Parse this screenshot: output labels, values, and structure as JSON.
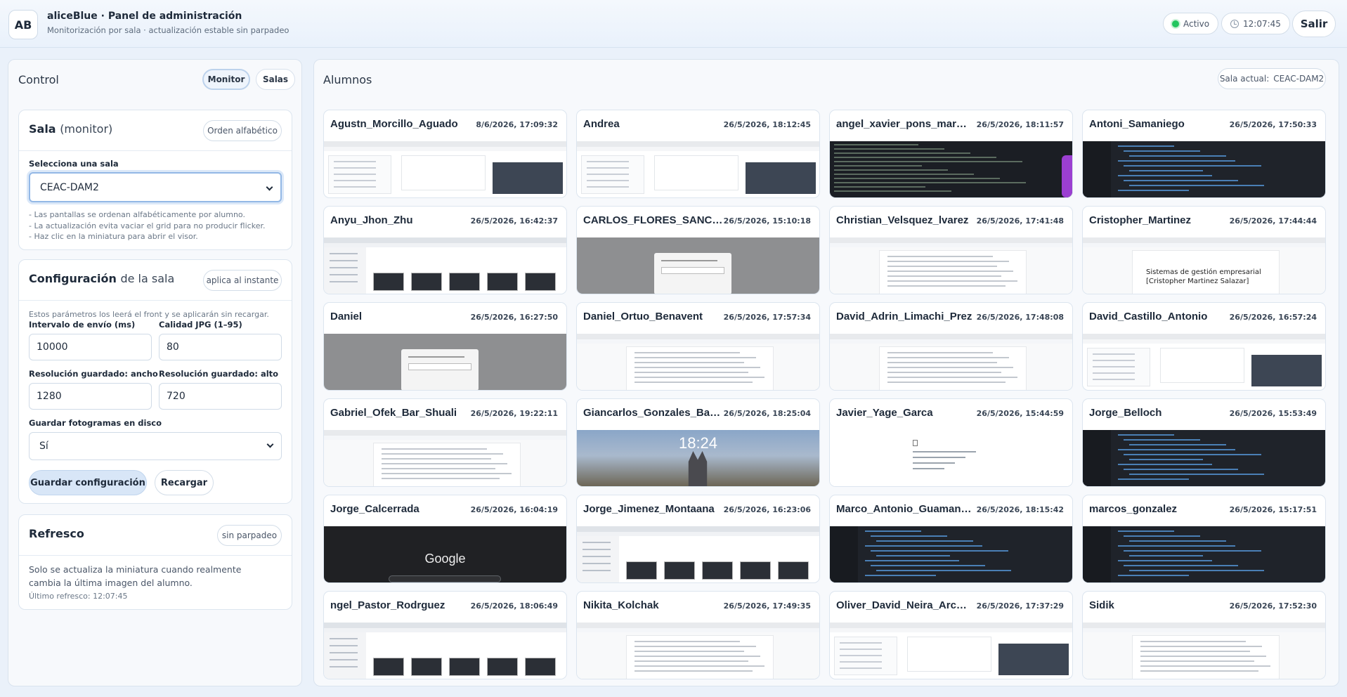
{
  "header": {
    "avatar": "AB",
    "title": "aliceBlue · Panel de administración",
    "subtitle": "Monitorización por sala · actualización estable sin parpadeo",
    "status": "Activo",
    "clock": "12:07:45",
    "exit": "Salir"
  },
  "control": {
    "title": "Control",
    "tabs": [
      "Monitor",
      "Salas"
    ],
    "sala": {
      "title": "Sala",
      "title_suffix": "(monitor)",
      "order_chip": "Orden alfabético",
      "select_label": "Selecciona una sala",
      "selected": "CEAC-DAM2",
      "hints": [
        "- Las pantallas se ordenan alfabéticamente por alumno.",
        "- La actualización evita vaciar el grid para no producir flicker.",
        "- Haz clic en la miniatura para abrir el visor."
      ]
    },
    "config": {
      "title": "Configuración",
      "title_suffix": "de la sala",
      "chip": "aplica al instante",
      "note": "Estos parámetros los leerá el front y se aplicarán sin recargar.",
      "interval_label": "Intervalo de envío (ms)",
      "interval_value": "10000",
      "quality_label": "Calidad JPG (1–95)",
      "quality_value": "80",
      "width_label": "Resolución guardado: ancho",
      "width_value": "1280",
      "height_label": "Resolución guardado: alto",
      "height_value": "720",
      "save_frames_label": "Guardar fotogramas en disco",
      "save_frames_value": "Sí",
      "save_button": "Guardar configuración",
      "reload_button": "Recargar"
    },
    "refresh": {
      "title": "Refresco",
      "chip": "sin parpadeo",
      "text": "Solo se actualiza la miniatura cuando realmente cambia la última imagen del alumno.",
      "last": "Último refresco: 12:07:45"
    }
  },
  "students": {
    "title": "Alumnos",
    "room_label": "Sala actual:",
    "room_value": "CEAC-DAM2",
    "tiles": [
      {
        "name": "Agustn_Morcillo_Aguado",
        "time": "8/6/2026, 17:09:32",
        "theme": "light"
      },
      {
        "name": "Andrea",
        "time": "26/5/2026, 18:12:45",
        "theme": "light"
      },
      {
        "name": "angel_xavier_pons_mar…",
        "time": "26/5/2026, 18:11:57",
        "theme": "terminal"
      },
      {
        "name": "Antoni_Samaniego",
        "time": "26/5/2026, 17:50:33",
        "theme": "dark"
      },
      {
        "name": "Anyu_Jhon_Zhu",
        "time": "26/5/2026, 16:42:37",
        "theme": "files"
      },
      {
        "name": "CARLOS_FLORES_SANC…",
        "time": "26/5/2026, 15:10:18",
        "theme": "dim"
      },
      {
        "name": "Christian_Velsquez_lvarez",
        "time": "26/5/2026, 17:41:48",
        "theme": "doc"
      },
      {
        "name": "Cristopher_Martinez",
        "time": "26/5/2026, 17:44:44",
        "theme": "doc"
      },
      {
        "name": "Daniel",
        "time": "26/5/2026, 16:27:50",
        "theme": "dim"
      },
      {
        "name": "Daniel_Ortuo_Benavent",
        "time": "26/5/2026, 17:57:34",
        "theme": "doc"
      },
      {
        "name": "David_Adrin_Limachi_Prez",
        "time": "26/5/2026, 17:48:08",
        "theme": "doc"
      },
      {
        "name": "David_Castillo_Antonio",
        "time": "26/5/2026, 16:57:24",
        "theme": "light"
      },
      {
        "name": "Gabriel_Ofek_Bar_Shuali",
        "time": "26/5/2026, 19:22:11",
        "theme": "doc"
      },
      {
        "name": "Giancarlos_Gonzales_Ba…",
        "time": "26/5/2026, 18:25:04",
        "theme": "lock"
      },
      {
        "name": "Javier_Yage_Garca",
        "time": "26/5/2026, 15:44:59",
        "theme": "blank"
      },
      {
        "name": "Jorge_Belloch",
        "time": "26/5/2026, 15:53:49",
        "theme": "dark"
      },
      {
        "name": "Jorge_Calcerrada",
        "time": "26/5/2026, 16:04:19",
        "theme": "google"
      },
      {
        "name": "Jorge_Jimenez_Montaana",
        "time": "26/5/2026, 16:23:06",
        "theme": "files"
      },
      {
        "name": "Marco_Antonio_Guaman…",
        "time": "26/5/2026, 18:15:42",
        "theme": "dark"
      },
      {
        "name": "marcos_gonzalez",
        "time": "26/5/2026, 15:17:51",
        "theme": "dark"
      },
      {
        "name": "ngel_Pastor_Rodrguez",
        "time": "26/5/2026, 18:06:49",
        "theme": "files"
      },
      {
        "name": "Nikita_Kolchak",
        "time": "26/5/2026, 17:49:35",
        "theme": "doc"
      },
      {
        "name": "Oliver_David_Neira_Arc…",
        "time": "26/5/2026, 17:37:29",
        "theme": "light"
      },
      {
        "name": "Sidik",
        "time": "26/5/2026, 17:52:30",
        "theme": "doc"
      }
    ],
    "thumb_texts": {
      "lock_time": "18:24",
      "google": "Google",
      "cristopher_doc": "Sistemas de gestión empresarial",
      "cristopher_doc2": "[Cristopher Martinez Salazar]"
    }
  },
  "colors": {
    "accent": "#93b8e6",
    "status_green": "#22c55e",
    "background": "#eaf1fa"
  }
}
